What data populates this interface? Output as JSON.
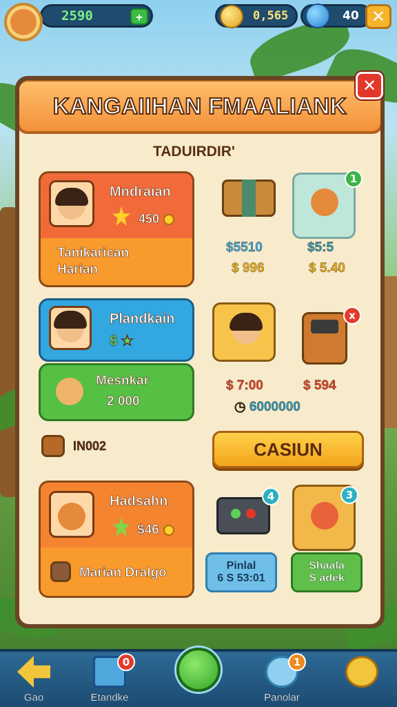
{
  "hud": {
    "green_currency": "2590",
    "gold_currency": "0,565",
    "blue_currency": "40",
    "plus_icon": "plus-icon",
    "close_icon": "close-icon"
  },
  "panel": {
    "title": "KANGAIIHAN FMAALIANK",
    "subtitle": "TADUIRDIR'",
    "close_label": "✕"
  },
  "cards": [
    {
      "name": "Mndraian",
      "price": "450",
      "subtitle_line1": "Tanikarican",
      "subtitle_line2": "Harian"
    },
    {
      "name": "Plandkain",
      "price": "$"
    },
    {
      "name": "Mesnkar",
      "price": "2 000"
    },
    {
      "name": "Hadsahn",
      "price": "$46",
      "subtitle": "Marian Dralgo"
    }
  ],
  "items": {
    "chest": {
      "price1": "$5510",
      "price2": "$ 996"
    },
    "fox_tile": {
      "badge": "1",
      "price1": "$5:5",
      "price2": "$ 5.40"
    },
    "chef_tile": {
      "price1": "$ 7:00",
      "price2": "6000000"
    },
    "machine": {
      "badge": "x",
      "price1": "$ 594"
    },
    "console": {
      "badge": "4"
    },
    "cat_tile": {
      "badge": "3"
    }
  },
  "misc": {
    "bag_label": "IN002",
    "big_button": "CASIUN",
    "btn_blue_line1": "Pinlal",
    "btn_blue_line2": "6 S 53:01",
    "btn_green_line1": "Shaala",
    "btn_green_line2": "S adek"
  },
  "nav": {
    "items": [
      {
        "label": "Gao"
      },
      {
        "label": "Etandke",
        "badge": "0"
      },
      {
        "label": ""
      },
      {
        "label": "Panolar",
        "badge": "1"
      },
      {
        "label": ""
      }
    ]
  },
  "colors": {
    "panel_bg": "#f8ebcc",
    "title_orange": "#f3913a",
    "accent_gold": "#f3a51c",
    "nav_blue": "#1d4b72"
  }
}
